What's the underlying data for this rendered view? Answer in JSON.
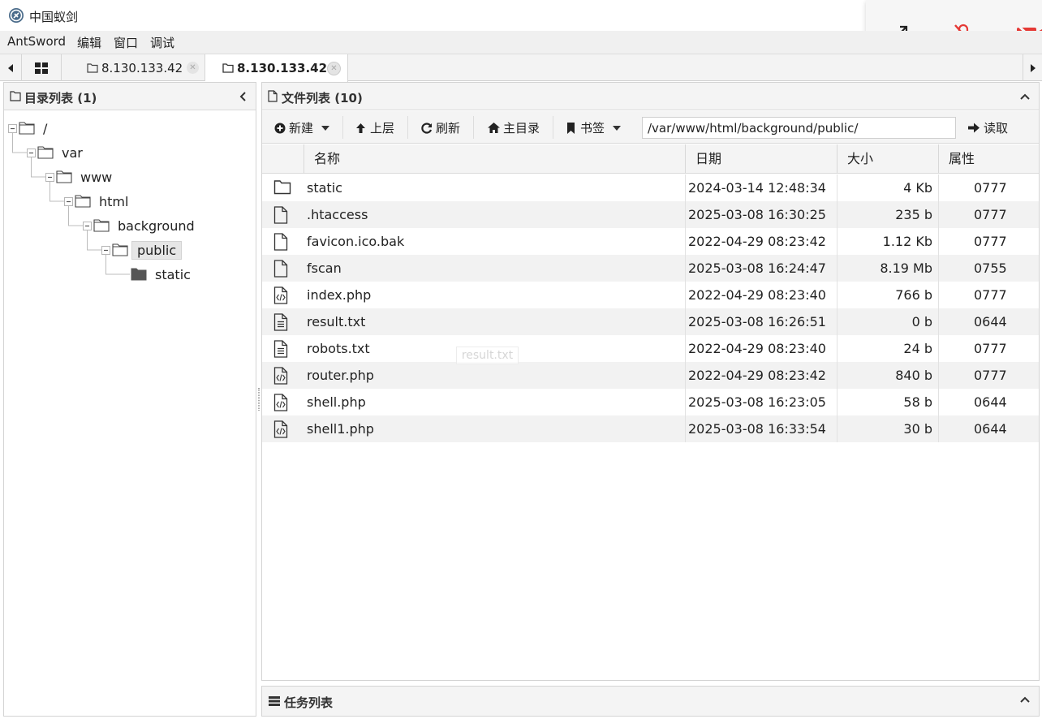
{
  "window": {
    "title": "中国蚁剑"
  },
  "menu": [
    "AntSword",
    "编辑",
    "窗口",
    "调试"
  ],
  "tabs": [
    {
      "label": "8.130.133.42",
      "active": false
    },
    {
      "label": "8.130.133.42",
      "active": true
    }
  ],
  "left_panel": {
    "title": "目录列表 (1)"
  },
  "tree": [
    {
      "label": "/",
      "depth": 0,
      "filled": false,
      "selected": false
    },
    {
      "label": "var",
      "depth": 1,
      "filled": false,
      "selected": false
    },
    {
      "label": "www",
      "depth": 2,
      "filled": false,
      "selected": false
    },
    {
      "label": "html",
      "depth": 3,
      "filled": false,
      "selected": false
    },
    {
      "label": "background",
      "depth": 4,
      "filled": false,
      "selected": false
    },
    {
      "label": "public",
      "depth": 5,
      "filled": false,
      "selected": true
    },
    {
      "label": "static",
      "depth": 6,
      "filled": true,
      "selected": false
    }
  ],
  "right_panel": {
    "title": "文件列表 (10)"
  },
  "toolbar": {
    "new_label": "新建",
    "up_label": "上层",
    "refresh_label": "刷新",
    "home_label": "主目录",
    "bookmark_label": "书签",
    "path_value": "/var/www/html/background/public/",
    "read_label": "读取"
  },
  "columns": {
    "name": "名称",
    "date": "日期",
    "size": "大小",
    "attr": "属性"
  },
  "files": [
    {
      "name": "static",
      "date": "2024-03-14 12:48:34",
      "size": "4 Kb",
      "attr": "0777",
      "icon": "folder"
    },
    {
      "name": ".htaccess",
      "date": "2025-03-08 16:30:25",
      "size": "235 b",
      "attr": "0777",
      "icon": "file"
    },
    {
      "name": "favicon.ico.bak",
      "date": "2022-04-29 08:23:42",
      "size": "1.12 Kb",
      "attr": "0777",
      "icon": "file"
    },
    {
      "name": "fscan",
      "date": "2025-03-08 16:24:47",
      "size": "8.19 Mb",
      "attr": "0755",
      "icon": "file"
    },
    {
      "name": "index.php",
      "date": "2022-04-29 08:23:40",
      "size": "766 b",
      "attr": "0777",
      "icon": "code"
    },
    {
      "name": "result.txt",
      "date": "2025-03-08 16:26:51",
      "size": "0 b",
      "attr": "0644",
      "icon": "text"
    },
    {
      "name": "robots.txt",
      "date": "2022-04-29 08:23:40",
      "size": "24 b",
      "attr": "0777",
      "icon": "text"
    },
    {
      "name": "router.php",
      "date": "2022-04-29 08:23:42",
      "size": "840 b",
      "attr": "0777",
      "icon": "code"
    },
    {
      "name": "shell.php",
      "date": "2025-03-08 16:23:05",
      "size": "58 b",
      "attr": "0644",
      "icon": "code"
    },
    {
      "name": "shell1.php",
      "date": "2025-03-08 16:33:54",
      "size": "30 b",
      "attr": "0644",
      "icon": "code"
    }
  ],
  "drag_ghost": "result.txt",
  "task_panel": {
    "title": "任务列表"
  },
  "colors": {
    "mute_red": "#e53935",
    "selected_bg": "#e6e6e6"
  }
}
